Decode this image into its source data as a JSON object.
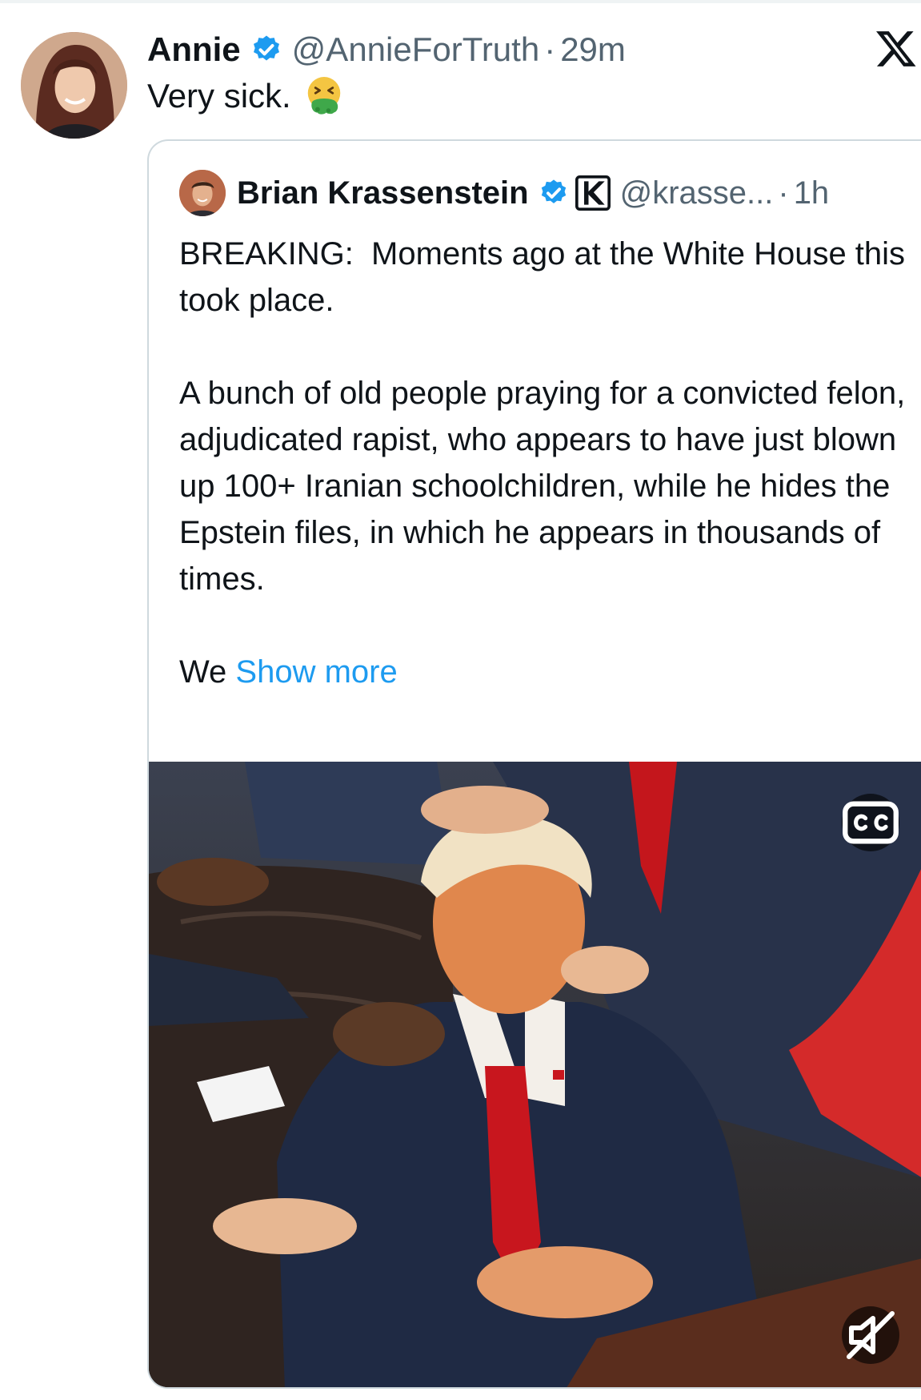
{
  "tweet": {
    "display_name": "Annie",
    "handle": "@AnnieForTruth",
    "separator": "·",
    "time": "29m",
    "text": "Very sick.",
    "emoji": "nauseated-face-emoji",
    "verified_color": "#1d9bf0"
  },
  "quote": {
    "display_name": "Brian Krassenstein",
    "affiliate_badge": "K",
    "handle": "@krasse...",
    "separator": "·",
    "time": "1h",
    "body": "BREAKING:  Moments ago at the White House this took place.\n\nA bunch of old people praying for a convicted felon, adjudicated rapist, who appears to have just blown up 100+ Iranian schoolchildren, while he hides the Epstein files, in which he appears in thousands of times.\n\nWe ",
    "show_more": "Show more",
    "link_color": "#1d9bf0"
  },
  "media": {
    "cc_icon": "closed-captions-icon",
    "mute_icon": "muted-speaker-icon"
  },
  "brand": {
    "logo": "x-logo-icon"
  }
}
